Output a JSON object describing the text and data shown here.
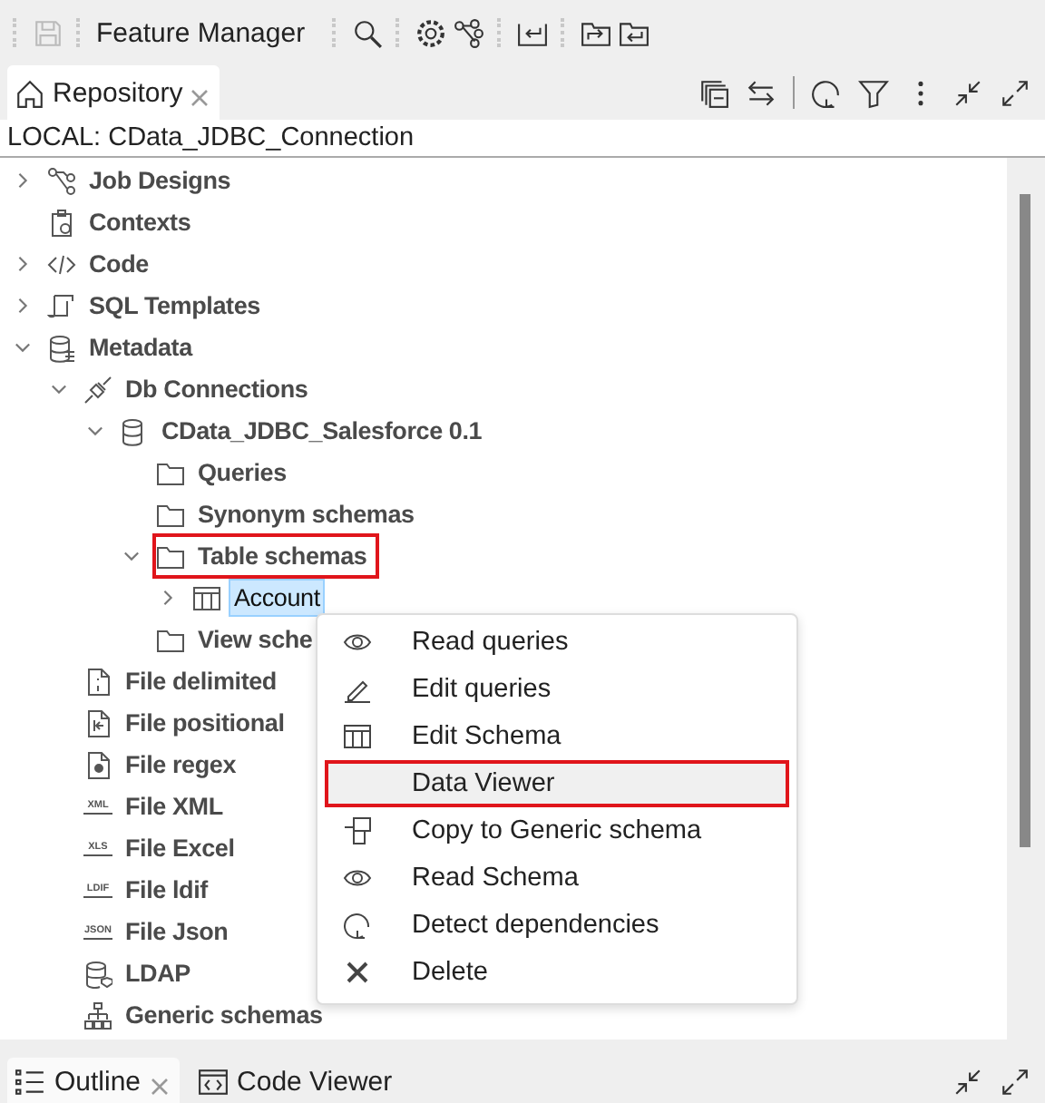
{
  "toolbar": {
    "title": "Feature Manager"
  },
  "repository_tab": {
    "label": "Repository",
    "selected": true
  },
  "path": "LOCAL: CData_JDBC_Connection",
  "tree": [
    {
      "label": "Job Designs",
      "kind": "job",
      "expanded": false,
      "selected": false
    },
    {
      "label": "Contexts",
      "kind": "contexts",
      "selected": false
    },
    {
      "label": "Code",
      "kind": "code",
      "expanded": false,
      "selected": false
    },
    {
      "label": "SQL Templates",
      "kind": "sql",
      "expanded": false,
      "selected": false
    },
    {
      "label": "Metadata",
      "kind": "metadata",
      "expanded": true,
      "selected": false,
      "children": [
        {
          "label": "Db Connections",
          "kind": "connection",
          "expanded": true,
          "selected": false,
          "children": [
            {
              "label": "CData_JDBC_Salesforce 0.1",
              "kind": "database",
              "expanded": true,
              "selected": false,
              "children": [
                {
                  "label": "Queries",
                  "kind": "folder",
                  "selected": false
                },
                {
                  "label": "Synonym schemas",
                  "kind": "folder",
                  "selected": false
                },
                {
                  "label": "Table schemas",
                  "kind": "folder",
                  "expanded": true,
                  "selected": false,
                  "highlighted": true,
                  "children": [
                    {
                      "label": "Account",
                      "kind": "table",
                      "expanded": false,
                      "selected": true
                    }
                  ]
                },
                {
                  "label": "View sche",
                  "kind": "folder",
                  "selected": false
                }
              ]
            }
          ]
        },
        {
          "label": "File delimited",
          "kind": "file-delimited",
          "selected": false
        },
        {
          "label": "File positional",
          "kind": "file-positional",
          "selected": false
        },
        {
          "label": "File regex",
          "kind": "file-regex",
          "selected": false
        },
        {
          "label": "File XML",
          "kind": "badge",
          "badge": "XML",
          "selected": false
        },
        {
          "label": "File Excel",
          "kind": "badge",
          "badge": "XLS",
          "selected": false
        },
        {
          "label": "File ldif",
          "kind": "badge",
          "badge": "LDIF",
          "selected": false
        },
        {
          "label": "File Json",
          "kind": "badge",
          "badge": "JSON",
          "selected": false
        },
        {
          "label": "LDAP",
          "kind": "ldap",
          "selected": false
        },
        {
          "label": "Generic schemas",
          "kind": "generic",
          "selected": false
        }
      ]
    }
  ],
  "context_menu": [
    {
      "label": "Read queries",
      "kind": "eye",
      "highlighted": false
    },
    {
      "label": "Edit queries",
      "kind": "pencil",
      "highlighted": false
    },
    {
      "label": "Edit Schema",
      "kind": "table",
      "highlighted": false
    },
    {
      "label": "Data Viewer",
      "kind": "none",
      "highlighted": true
    },
    {
      "label": "Copy to Generic schema",
      "kind": "copy",
      "highlighted": false
    },
    {
      "label": "Read Schema",
      "kind": "eye",
      "highlighted": false
    },
    {
      "label": "Detect dependencies",
      "kind": "refresh",
      "highlighted": false
    },
    {
      "label": "Delete",
      "kind": "delete",
      "highlighted": false
    }
  ],
  "bottom_tabs": [
    {
      "label": "Outline",
      "kind": "outline",
      "selected": true
    },
    {
      "label": "Code Viewer",
      "kind": "code-viewer",
      "selected": false
    }
  ]
}
